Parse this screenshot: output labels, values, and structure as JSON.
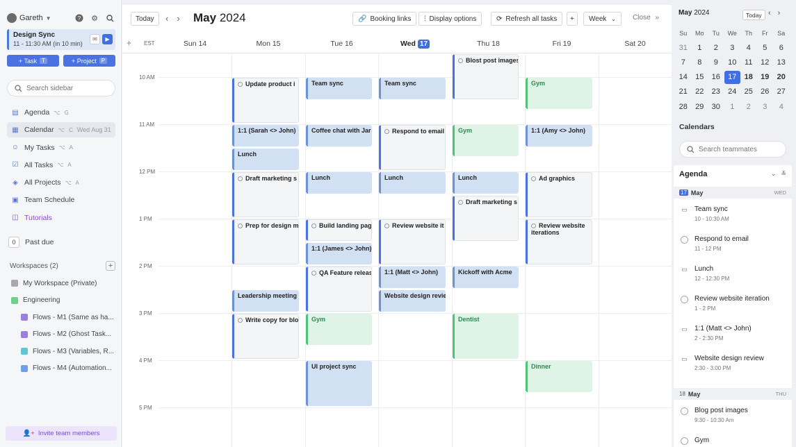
{
  "sidebar": {
    "user_name": "Gareth",
    "current_event": {
      "title": "Design Sync",
      "time": "11 - 11:30 AM (in 10 min)"
    },
    "task_button": {
      "label": "+ Task",
      "shortcut": "T"
    },
    "project_button": {
      "label": "+ Project",
      "shortcut": "P"
    },
    "search_placeholder": "Search sidebar",
    "nav": [
      {
        "label": "Agenda",
        "shortcut": "⌥ G"
      },
      {
        "label": "Calendar",
        "shortcut": "⌥ C",
        "date": "Wed Aug 31"
      },
      {
        "label": "My Tasks",
        "shortcut": "⌥ A"
      },
      {
        "label": "All Tasks",
        "shortcut": "⌥ A"
      },
      {
        "label": "All Projects",
        "shortcut": "⌥ A"
      },
      {
        "label": "Team Schedule",
        "shortcut": ""
      },
      {
        "label": "Tutorials",
        "shortcut": ""
      }
    ],
    "past_due": {
      "count": "0",
      "label": "Past due"
    },
    "workspaces_label": "Workspaces (2)",
    "workspaces": [
      {
        "label": "My Workspace (Private)",
        "color": "#a9a9a9"
      },
      {
        "label": "Engineering",
        "color": "#6fcf8f"
      },
      {
        "label": "Flows - M1 (Same as ha...",
        "color": "#9b7fe0"
      },
      {
        "label": "Flows - M2 (Ghost Task...",
        "color": "#9b7fe0"
      },
      {
        "label": "Flows - M3 (Variables, R...",
        "color": "#5fc6d8"
      },
      {
        "label": "Flows - M4 (Automation...",
        "color": "#6f9fe8"
      }
    ],
    "invite_label": "Invite team members"
  },
  "toolbar": {
    "today": "Today",
    "month": "May",
    "year": "2024",
    "booking_links": "Booking links",
    "display_options": "Display options",
    "refresh": "Refresh all tasks",
    "view": "Week",
    "close": "Close"
  },
  "week": {
    "timezone": "EST",
    "days": [
      {
        "label": "Sun 14"
      },
      {
        "label": "Mon 15"
      },
      {
        "label": "Tue 16"
      },
      {
        "label": "Wed",
        "badge": "17",
        "today": true
      },
      {
        "label": "Thu 18"
      },
      {
        "label": "Fri  19"
      },
      {
        "label": "Sat 20"
      }
    ],
    "time_labels": [
      "10 AM",
      "11 AM",
      "12 PM",
      "1 PM",
      "2 PM",
      "3 PM",
      "4 PM",
      "5 PM"
    ]
  },
  "events": [
    {
      "day": 1,
      "start": 10.0,
      "end": 11.0,
      "title": "Update product i",
      "kind": "task"
    },
    {
      "day": 1,
      "start": 11.0,
      "end": 11.5,
      "title": "1:1 (Sarah <> John)",
      "kind": "blue"
    },
    {
      "day": 1,
      "start": 11.5,
      "end": 12.0,
      "title": "Lunch",
      "kind": "blue"
    },
    {
      "day": 1,
      "start": 12.0,
      "end": 13.0,
      "title": "Draft marketing s",
      "kind": "task"
    },
    {
      "day": 1,
      "start": 13.0,
      "end": 14.0,
      "title": "Prep for design m",
      "kind": "task"
    },
    {
      "day": 1,
      "start": 14.5,
      "end": 15.0,
      "title": "Leadership meeting",
      "kind": "blue"
    },
    {
      "day": 1,
      "start": 15.0,
      "end": 16.0,
      "title": "Write copy for blo",
      "kind": "task"
    },
    {
      "day": 2,
      "start": 10.0,
      "end": 10.5,
      "title": "Team sync",
      "kind": "blue"
    },
    {
      "day": 2,
      "start": 11.0,
      "end": 11.5,
      "title": "Coffee chat with Jar",
      "kind": "blue"
    },
    {
      "day": 2,
      "start": 12.0,
      "end": 12.5,
      "title": "Lunch",
      "kind": "blue"
    },
    {
      "day": 2,
      "start": 13.0,
      "end": 13.5,
      "title": "Build landing pag",
      "kind": "task"
    },
    {
      "day": 2,
      "start": 13.5,
      "end": 14.0,
      "title": "1:1 (James <> John)",
      "kind": "blue"
    },
    {
      "day": 2,
      "start": 14.0,
      "end": 15.0,
      "title": "QA Feature releas",
      "kind": "task"
    },
    {
      "day": 2,
      "start": 15.0,
      "end": 15.7,
      "title": "Gym",
      "kind": "green"
    },
    {
      "day": 2,
      "start": 16.0,
      "end": 17.0,
      "title": "UI project sync",
      "kind": "blue"
    },
    {
      "day": 3,
      "start": 10.0,
      "end": 10.5,
      "title": "Team sync",
      "kind": "blue"
    },
    {
      "day": 3,
      "start": 11.0,
      "end": 12.0,
      "title": "Respond to email",
      "kind": "task"
    },
    {
      "day": 3,
      "start": 12.0,
      "end": 12.5,
      "title": "Lunch",
      "kind": "blue"
    },
    {
      "day": 3,
      "start": 13.0,
      "end": 14.0,
      "title": "Review website it",
      "kind": "task"
    },
    {
      "day": 3,
      "start": 14.0,
      "end": 14.5,
      "title": "1:1 (Matt <> John)",
      "kind": "blue"
    },
    {
      "day": 3,
      "start": 14.5,
      "end": 15.0,
      "title": "Website design revie",
      "kind": "blue"
    },
    {
      "day": 4,
      "start": 9.5,
      "end": 10.5,
      "title": "Blost post images",
      "kind": "task"
    },
    {
      "day": 4,
      "start": 11.0,
      "end": 11.7,
      "title": "Gym",
      "kind": "green"
    },
    {
      "day": 4,
      "start": 12.0,
      "end": 12.5,
      "title": "Lunch",
      "kind": "blue"
    },
    {
      "day": 4,
      "start": 12.5,
      "end": 13.5,
      "title": "Draft marketing s",
      "kind": "task"
    },
    {
      "day": 4,
      "start": 14.0,
      "end": 14.5,
      "title": "Kickoff with Acme",
      "kind": "blue"
    },
    {
      "day": 4,
      "start": 15.0,
      "end": 16.0,
      "title": "Dentist",
      "kind": "green"
    },
    {
      "day": 5,
      "start": 10.0,
      "end": 10.7,
      "title": "Gym",
      "kind": "green"
    },
    {
      "day": 5,
      "start": 11.0,
      "end": 11.5,
      "title": "1:1 (Amy <> John)",
      "kind": "blue"
    },
    {
      "day": 5,
      "start": 12.0,
      "end": 13.0,
      "title": "Ad graphics",
      "kind": "task"
    },
    {
      "day": 5,
      "start": 13.0,
      "end": 14.0,
      "title": "Review website iterations",
      "kind": "task"
    },
    {
      "day": 5,
      "start": 16.0,
      "end": 16.7,
      "title": "Dinner",
      "kind": "green"
    }
  ],
  "mini_calendar": {
    "month": "May",
    "year": "2024",
    "today_label": "Today",
    "weekdays": [
      "Su",
      "Mo",
      "Tu",
      "We",
      "Th",
      "Fr",
      "Sa"
    ],
    "weeks": [
      [
        "31",
        "1",
        "2",
        "3",
        "4",
        "5",
        "6"
      ],
      [
        "7",
        "8",
        "9",
        "10",
        "11",
        "12",
        "13"
      ],
      [
        "14",
        "15",
        "16",
        "17",
        "18",
        "19",
        "20"
      ],
      [
        "21",
        "22",
        "23",
        "24",
        "25",
        "26",
        "27"
      ],
      [
        "28",
        "29",
        "30",
        "1",
        "2",
        "3",
        "4"
      ]
    ],
    "selected": "17"
  },
  "calendars": {
    "title": "Calendars",
    "search_placeholder": "Search teammates"
  },
  "agenda": {
    "title": "Agenda",
    "days": [
      {
        "num": "17",
        "month": "May",
        "weekday": "WED",
        "items": [
          {
            "title": "Team sync",
            "time": "10 - 10:30 AM",
            "kind": "event"
          },
          {
            "title": "Respond to email",
            "time": "11 - 12 PM",
            "kind": "task"
          },
          {
            "title": "Lunch",
            "time": "12 - 12:30 PM",
            "kind": "event"
          },
          {
            "title": "Review website iteration",
            "time": "1 - 2 PM",
            "kind": "task"
          },
          {
            "title": "1:1 (Matt <> John)",
            "time": "2 - 2:30 PM",
            "kind": "event"
          },
          {
            "title": "Website design review",
            "time": "2:30 - 3:00 PM",
            "kind": "event"
          }
        ]
      },
      {
        "num": "18",
        "month": "May",
        "weekday": "THU",
        "items": [
          {
            "title": "Blog post images",
            "time": "9:30 - 10:30 Am",
            "kind": "task"
          },
          {
            "title": "Gym",
            "time": "",
            "kind": "task"
          }
        ]
      }
    ]
  }
}
